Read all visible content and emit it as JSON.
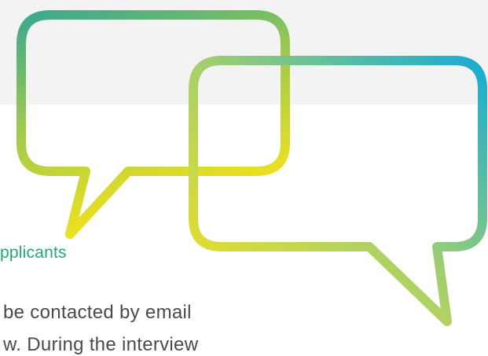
{
  "colors": {
    "top_band": "#f3f3f3",
    "heading": "#22a873",
    "body_text": "#4a4a4a",
    "gradient_teal": "#3fae8d",
    "gradient_cyan": "#1fb0d0",
    "gradient_yellow": "#f7e21a"
  },
  "section": {
    "heading": "pplicants",
    "body_lines": [
      "be contacted by email",
      "w. During the interview"
    ]
  }
}
